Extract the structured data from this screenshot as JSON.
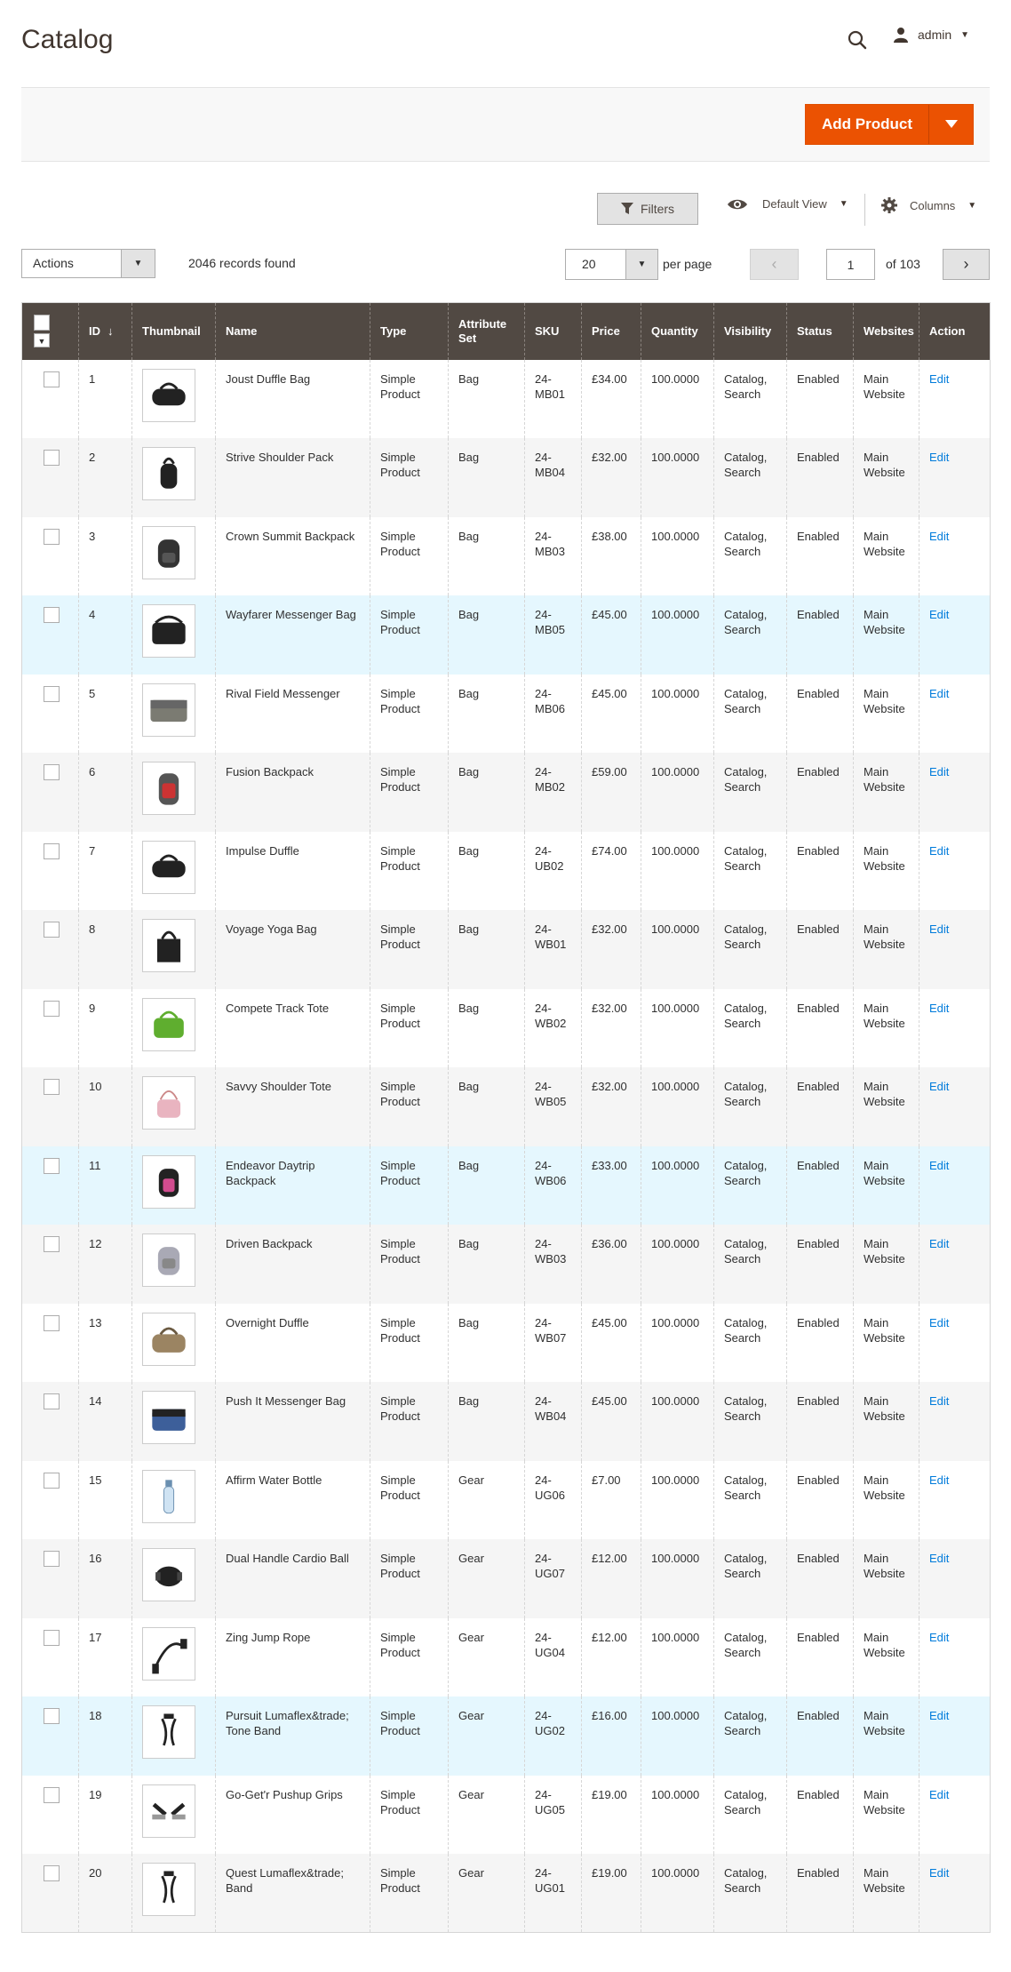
{
  "header": {
    "title": "Catalog",
    "user": "admin"
  },
  "actions": {
    "add_product": "Add Product"
  },
  "toolbar": {
    "filters": "Filters",
    "view": "Default View",
    "columns": "Columns",
    "mass_actions": "Actions",
    "records": "2046 records found",
    "per_page_value": "20",
    "per_page_label": "per page",
    "page": "1",
    "page_of": "of 103"
  },
  "columns": [
    "ID",
    "Thumbnail",
    "Name",
    "Type",
    "Attribute Set",
    "SKU",
    "Price",
    "Quantity",
    "Visibility",
    "Status",
    "Websites",
    "Action"
  ],
  "rows": [
    {
      "id": "1",
      "name": "Joust Duffle Bag",
      "type": "Simple Product",
      "set": "Bag",
      "sku": "24-MB01",
      "price": "£34.00",
      "qty": "100.0000",
      "vis": "Catalog, Search",
      "status": "Enabled",
      "web": "Main Website",
      "action": "Edit",
      "thumb": "duffle"
    },
    {
      "id": "2",
      "name": "Strive Shoulder Pack",
      "type": "Simple Product",
      "set": "Bag",
      "sku": "24-MB04",
      "price": "£32.00",
      "qty": "100.0000",
      "vis": "Catalog, Search",
      "status": "Enabled",
      "web": "Main Website",
      "action": "Edit",
      "thumb": "pack"
    },
    {
      "id": "3",
      "name": "Crown Summit Backpack",
      "type": "Simple Product",
      "set": "Bag",
      "sku": "24-MB03",
      "price": "£38.00",
      "qty": "100.0000",
      "vis": "Catalog, Search",
      "status": "Enabled",
      "web": "Main Website",
      "action": "Edit",
      "thumb": "backpack"
    },
    {
      "id": "4",
      "name": "Wayfarer Messenger Bag",
      "type": "Simple Product",
      "set": "Bag",
      "sku": "24-MB05",
      "price": "£45.00",
      "qty": "100.0000",
      "vis": "Catalog, Search",
      "status": "Enabled",
      "web": "Main Website",
      "action": "Edit",
      "thumb": "messenger"
    },
    {
      "id": "5",
      "name": "Rival Field Messenger",
      "type": "Simple Product",
      "set": "Bag",
      "sku": "24-MB06",
      "price": "£45.00",
      "qty": "100.0000",
      "vis": "Catalog, Search",
      "status": "Enabled",
      "web": "Main Website",
      "action": "Edit",
      "thumb": "field"
    },
    {
      "id": "6",
      "name": "Fusion Backpack",
      "type": "Simple Product",
      "set": "Bag",
      "sku": "24-MB02",
      "price": "£59.00",
      "qty": "100.0000",
      "vis": "Catalog, Search",
      "status": "Enabled",
      "web": "Main Website",
      "action": "Edit",
      "thumb": "fusion"
    },
    {
      "id": "7",
      "name": "Impulse Duffle",
      "type": "Simple Product",
      "set": "Bag",
      "sku": "24-UB02",
      "price": "£74.00",
      "qty": "100.0000",
      "vis": "Catalog, Search",
      "status": "Enabled",
      "web": "Main Website",
      "action": "Edit",
      "thumb": "duffle"
    },
    {
      "id": "8",
      "name": "Voyage Yoga Bag",
      "type": "Simple Product",
      "set": "Bag",
      "sku": "24-WB01",
      "price": "£32.00",
      "qty": "100.0000",
      "vis": "Catalog, Search",
      "status": "Enabled",
      "web": "Main Website",
      "action": "Edit",
      "thumb": "tote"
    },
    {
      "id": "9",
      "name": "Compete Track Tote",
      "type": "Simple Product",
      "set": "Bag",
      "sku": "24-WB02",
      "price": "£32.00",
      "qty": "100.0000",
      "vis": "Catalog, Search",
      "status": "Enabled",
      "web": "Main Website",
      "action": "Edit",
      "thumb": "green-tote"
    },
    {
      "id": "10",
      "name": "Savvy Shoulder Tote",
      "type": "Simple Product",
      "set": "Bag",
      "sku": "24-WB05",
      "price": "£32.00",
      "qty": "100.0000",
      "vis": "Catalog, Search",
      "status": "Enabled",
      "web": "Main Website",
      "action": "Edit",
      "thumb": "pink-tote"
    },
    {
      "id": "11",
      "name": "Endeavor Daytrip Backpack",
      "type": "Simple Product",
      "set": "Bag",
      "sku": "24-WB06",
      "price": "£33.00",
      "qty": "100.0000",
      "vis": "Catalog, Search",
      "status": "Enabled",
      "web": "Main Website",
      "action": "Edit",
      "thumb": "pink-backpack"
    },
    {
      "id": "12",
      "name": "Driven Backpack",
      "type": "Simple Product",
      "set": "Bag",
      "sku": "24-WB03",
      "price": "£36.00",
      "qty": "100.0000",
      "vis": "Catalog, Search",
      "status": "Enabled",
      "web": "Main Website",
      "action": "Edit",
      "thumb": "grey-backpack"
    },
    {
      "id": "13",
      "name": "Overnight Duffle",
      "type": "Simple Product",
      "set": "Bag",
      "sku": "24-WB07",
      "price": "£45.00",
      "qty": "100.0000",
      "vis": "Catalog, Search",
      "status": "Enabled",
      "web": "Main Website",
      "action": "Edit",
      "thumb": "tan-duffle"
    },
    {
      "id": "14",
      "name": "Push It Messenger Bag",
      "type": "Simple Product",
      "set": "Bag",
      "sku": "24-WB04",
      "price": "£45.00",
      "qty": "100.0000",
      "vis": "Catalog, Search",
      "status": "Enabled",
      "web": "Main Website",
      "action": "Edit",
      "thumb": "blue-messenger"
    },
    {
      "id": "15",
      "name": "Affirm Water Bottle",
      "type": "Simple Product",
      "set": "Gear",
      "sku": "24-UG06",
      "price": "£7.00",
      "qty": "100.0000",
      "vis": "Catalog, Search",
      "status": "Enabled",
      "web": "Main Website",
      "action": "Edit",
      "thumb": "bottle"
    },
    {
      "id": "16",
      "name": "Dual Handle Cardio Ball",
      "type": "Simple Product",
      "set": "Gear",
      "sku": "24-UG07",
      "price": "£12.00",
      "qty": "100.0000",
      "vis": "Catalog, Search",
      "status": "Enabled",
      "web": "Main Website",
      "action": "Edit",
      "thumb": "ball"
    },
    {
      "id": "17",
      "name": "Zing Jump Rope",
      "type": "Simple Product",
      "set": "Gear",
      "sku": "24-UG04",
      "price": "£12.00",
      "qty": "100.0000",
      "vis": "Catalog, Search",
      "status": "Enabled",
      "web": "Main Website",
      "action": "Edit",
      "thumb": "rope"
    },
    {
      "id": "18",
      "name": "Pursuit Lumaflex&trade; Tone Band",
      "type": "Simple Product",
      "set": "Gear",
      "sku": "24-UG02",
      "price": "£16.00",
      "qty": "100.0000",
      "vis": "Catalog, Search",
      "status": "Enabled",
      "web": "Main Website",
      "action": "Edit",
      "thumb": "band"
    },
    {
      "id": "19",
      "name": "Go-Get'r Pushup Grips",
      "type": "Simple Product",
      "set": "Gear",
      "sku": "24-UG05",
      "price": "£19.00",
      "qty": "100.0000",
      "vis": "Catalog, Search",
      "status": "Enabled",
      "web": "Main Website",
      "action": "Edit",
      "thumb": "grips"
    },
    {
      "id": "20",
      "name": "Quest Lumaflex&trade; Band",
      "type": "Simple Product",
      "set": "Gear",
      "sku": "24-UG01",
      "price": "£19.00",
      "qty": "100.0000",
      "vis": "Catalog, Search",
      "status": "Enabled",
      "web": "Main Website",
      "action": "Edit",
      "thumb": "band"
    }
  ]
}
